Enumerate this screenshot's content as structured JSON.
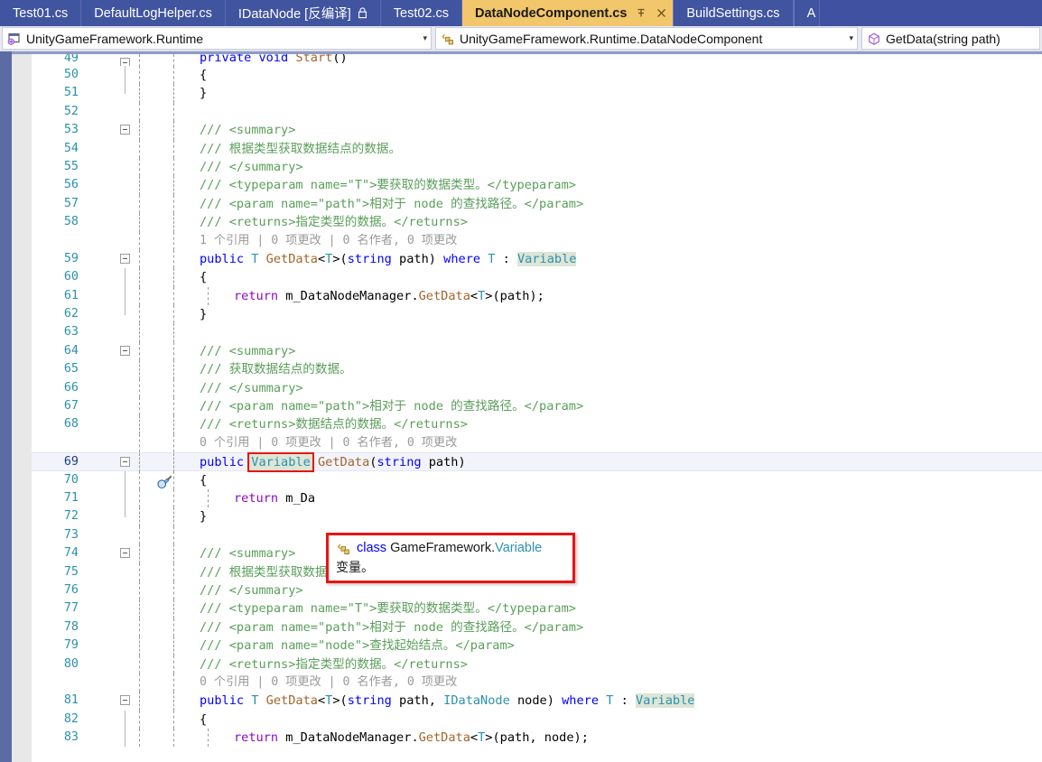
{
  "tabs": [
    {
      "label": "Test01.cs",
      "active": false,
      "lock": false
    },
    {
      "label": "DefaultLogHelper.cs",
      "active": false,
      "lock": false
    },
    {
      "label": "IDataNode [反编译]",
      "active": false,
      "lock": true
    },
    {
      "label": "Test02.cs",
      "active": false,
      "lock": false
    },
    {
      "label": "DataNodeComponent.cs",
      "active": true,
      "lock": false
    },
    {
      "label": "BuildSettings.cs",
      "active": false,
      "lock": false
    },
    {
      "label": "A",
      "active": false,
      "lock": false
    }
  ],
  "nav": {
    "project": "UnityGameFramework.Runtime",
    "type": "UnityGameFramework.Runtime.DataNodeComponent",
    "member": "GetData(string path)",
    "caret": "▾",
    "project_icon": "project-icon",
    "type_icon": "class-icon",
    "member_icon": "method-icon"
  },
  "editor": {
    "current_line": 69,
    "codelens_text": "0 个引用 | 0 项更改 | 0 名作者, 0 项更改",
    "codelens_text_1ref": "1 个引用 | 0 项更改 | 0 名作者, 0 项更改",
    "lines": [
      {
        "n": 49,
        "partial": true
      },
      {
        "n": 50
      },
      {
        "n": 51
      },
      {
        "n": 52
      },
      {
        "n": 53
      },
      {
        "n": 54
      },
      {
        "n": 55
      },
      {
        "n": 56
      },
      {
        "n": 57
      },
      {
        "n": 58
      },
      {
        "n": 59
      },
      {
        "n": 60
      },
      {
        "n": 61
      },
      {
        "n": 62
      },
      {
        "n": 63
      },
      {
        "n": 64
      },
      {
        "n": 65
      },
      {
        "n": 66
      },
      {
        "n": 67
      },
      {
        "n": 68
      },
      {
        "n": 69
      },
      {
        "n": 70
      },
      {
        "n": 71
      },
      {
        "n": 72
      },
      {
        "n": 73
      },
      {
        "n": 74
      },
      {
        "n": 75
      },
      {
        "n": 76
      },
      {
        "n": 77
      },
      {
        "n": 78
      },
      {
        "n": 79
      },
      {
        "n": 80
      },
      {
        "n": 81
      },
      {
        "n": 82
      },
      {
        "n": 83
      }
    ],
    "code": {
      "l49": "private void Start()",
      "l50": "{",
      "l51": "}",
      "l53": "/// <summary>",
      "l54": "/// 根据类型获取数据结点的数据。",
      "l55": "/// </summary>",
      "l56": "/// <typeparam name=\"T\">要获取的数据类型。</typeparam>",
      "l57": "/// <param name=\"path\">相对于 node 的查找路径。</param>",
      "l58": "/// <returns>指定类型的数据。</returns>",
      "l59": "public T GetData<T>(string path) where T : Variable",
      "l60": "{",
      "l61": "return m_DataNodeManager.GetData<T>(path);",
      "l62": "}",
      "l64": "/// <summary>",
      "l65": "/// 获取数据结点的数据。",
      "l66": "/// </summary>",
      "l67": "/// <param name=\"path\">相对于 node 的查找路径。</param>",
      "l68": "/// <returns>数据结点的数据。</returns>",
      "l69": "public Variable GetData(string path)",
      "l70": "{",
      "l71": "return m_Da",
      "l72": "}",
      "l74": "/// <summary>",
      "l75": "/// 根据类型获取数据结点的数据。",
      "l76": "/// </summary>",
      "l77": "/// <typeparam name=\"T\">要获取的数据类型。</typeparam>",
      "l78": "/// <param name=\"path\">相对于 node 的查找路径。</param>",
      "l79": "/// <param name=\"node\">查找起始结点。</param>",
      "l80": "/// <returns>指定类型的数据。</returns>",
      "l81": "public T GetData<T>(string path, IDataNode node) where T : Variable",
      "l82": "{",
      "l83": "return m_DataNodeManager.GetData<T>(path, node);"
    }
  },
  "tooltip": {
    "icon": "class-icon",
    "keyword": "class",
    "namespace": "GameFramework.",
    "classname": "Variable",
    "description": "变量。"
  },
  "colors": {
    "tabstrip_bg": "#3f51a0",
    "active_tab_bg": "#f2c66a",
    "left_stripe": "#5b6ba6",
    "tooltip_border": "#e81414",
    "highlight_token_bg": "#dde5d6",
    "current_line_bg": "#f3f4fb",
    "line_number": "#2b91af"
  }
}
